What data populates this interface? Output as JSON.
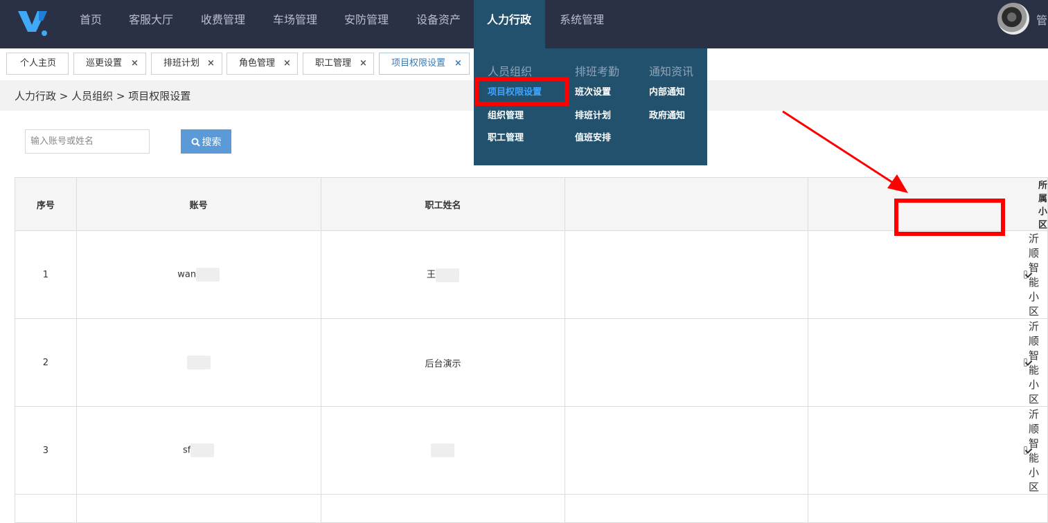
{
  "topnav": {
    "items": [
      "首页",
      "客服大厅",
      "收费管理",
      "车场管理",
      "安防管理",
      "设备资产",
      "人力行政",
      "系统管理"
    ],
    "active": "人力行政",
    "user_label": "管"
  },
  "tabs": [
    {
      "label": "个人主页",
      "closable": false
    },
    {
      "label": "巡更设置",
      "closable": true
    },
    {
      "label": "排班计划",
      "closable": true
    },
    {
      "label": "角色管理",
      "closable": true
    },
    {
      "label": "职工管理",
      "closable": true
    },
    {
      "label": "项目权限设置",
      "closable": true
    }
  ],
  "tab_close_glyph": "×",
  "breadcrumb": "人力行政 > 人员组织 > 项目权限设置",
  "search": {
    "placeholder": "输入账号或姓名",
    "button_label": "搜索"
  },
  "table": {
    "headers": [
      "序号",
      "账号",
      "职工姓名",
      "",
      "所属小区"
    ],
    "rows": [
      {
        "index": "1",
        "account": "wan",
        "name": "王",
        "community": "沂顺智能小区",
        "checked": true
      },
      {
        "index": "2",
        "account": "",
        "name": "后台演示",
        "community": "沂顺智能小区",
        "checked": true
      },
      {
        "index": "3",
        "account": "sf",
        "name": "",
        "community": "沂顺智能小区",
        "checked": true
      }
    ]
  },
  "menu": {
    "columns": [
      {
        "heading": "人员组织",
        "items": [
          "项目权限设置",
          "组织管理",
          "职工管理"
        ]
      },
      {
        "heading": "排班考勤",
        "items": [
          "班次设置",
          "排班计划",
          "值班安排"
        ]
      },
      {
        "heading": "通知资讯",
        "items": [
          "内部通知",
          "政府通知"
        ]
      }
    ],
    "active_item": "项目权限设置"
  },
  "colors": {
    "topbar": "#2b3145",
    "menu_bg": "#22516d",
    "accent": "#5b9ad6",
    "annotation": "#ff0000"
  }
}
